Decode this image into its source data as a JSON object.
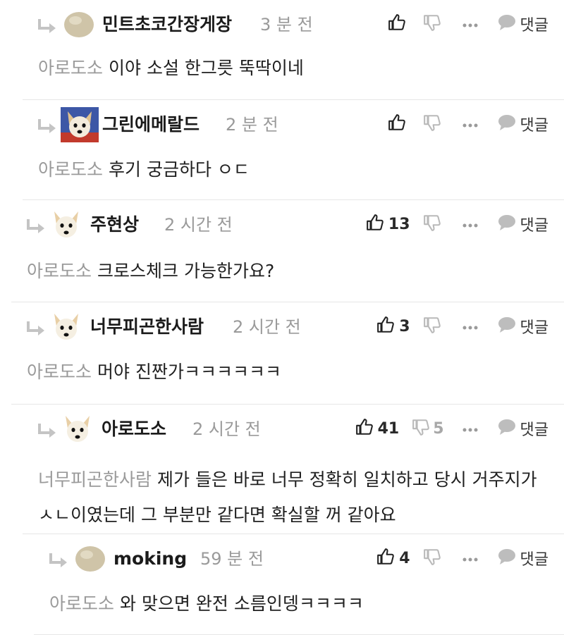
{
  "ui": {
    "reply_label": "댓글"
  },
  "comments": [
    {
      "author": "민트초코간장게장",
      "time": "3 분 전",
      "likes": "",
      "dislikes": "",
      "mention": "아로도소",
      "text": "이야 소설 한그릇 뚝딱이네",
      "avatar": "blob-avatar"
    },
    {
      "author": "그린에메랄드",
      "time": "2 분 전",
      "likes": "",
      "dislikes": "",
      "mention": "아로도소",
      "text": "후기 궁금하다 ㅇㄷ",
      "avatar": "dog-avatar-blue"
    },
    {
      "author": "주현상",
      "time": "2 시간 전",
      "likes": "13",
      "dislikes": "",
      "mention": "아로도소",
      "text": "크로스체크 가능한가요?",
      "avatar": "dog-avatar"
    },
    {
      "author": "너무피곤한사람",
      "time": "2 시간 전",
      "likes": "3",
      "dislikes": "",
      "mention": "아로도소",
      "text": "머야 진짠가ㅋㅋㅋㅋㅋㅋ",
      "avatar": "dog-avatar"
    },
    {
      "author": "아로도소",
      "time": "2 시간 전",
      "likes": "41",
      "dislikes": "5",
      "mention": "너무피곤한사람",
      "text": "제가 들은 바로 너무 정확히 일치하고 당시 거주지가 ㅅㄴ이였는데 그 부분만 같다면 확실할 꺼 같아요",
      "avatar": "dog-avatar"
    },
    {
      "author": "moking",
      "time": "59 분 전",
      "likes": "4",
      "dislikes": "",
      "mention": "아로도소",
      "text": "와 맞으면 완전 소름인뎅ㅋㅋㅋㅋ",
      "avatar": "blob-avatar"
    }
  ]
}
